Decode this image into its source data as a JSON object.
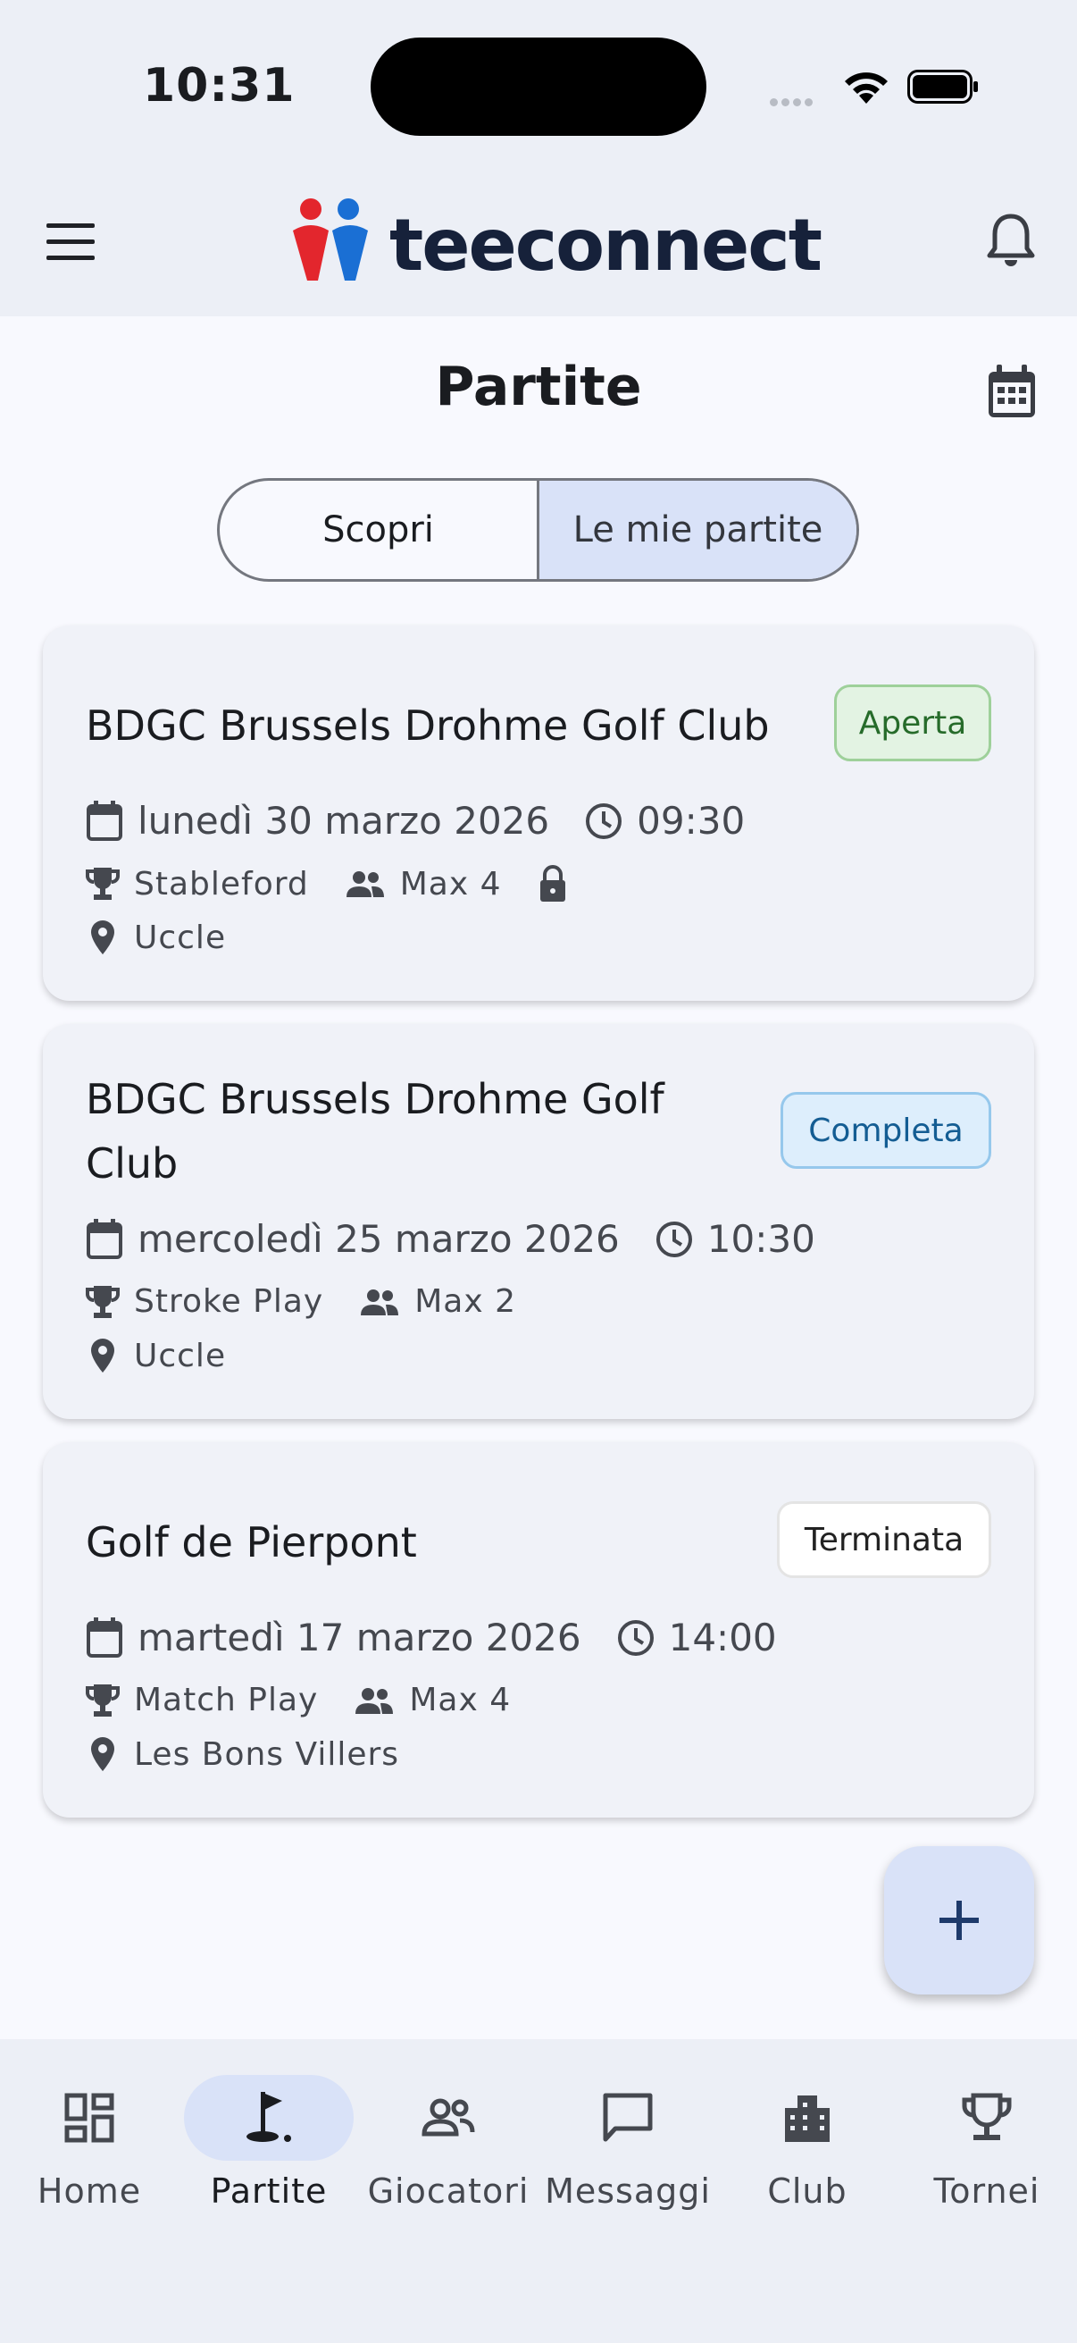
{
  "status": {
    "time": "10:31"
  },
  "header": {
    "app_name": "teeconnect"
  },
  "page": {
    "title": "Partite"
  },
  "tabs": [
    {
      "label": "Scopri",
      "active": false
    },
    {
      "label": "Le mie partite",
      "active": true
    }
  ],
  "matches": [
    {
      "club": "BDGC Brussels Drohme Golf Club",
      "status": "Aperta",
      "date": "lunedì 30 marzo 2026",
      "time": "09:30",
      "format": "Stableford",
      "players": "Max 4",
      "locked": true,
      "location": "Uccle"
    },
    {
      "club_line1": "BDGC Brussels Drohme Golf",
      "club_line2": "Club",
      "status": "Completa",
      "date": "mercoledì 25 marzo 2026",
      "time": "10:30",
      "format": "Stroke Play",
      "players": "Max 2",
      "location": "Uccle"
    },
    {
      "club": "Golf de Pierpont",
      "status": "Terminata",
      "date": "martedì 17 marzo 2026",
      "time": "14:00",
      "format": "Match Play",
      "players": "Max 4",
      "location": "Les Bons Villers"
    }
  ],
  "fab": {
    "icon": "plus-icon"
  },
  "bottom_nav": [
    {
      "label": "Home",
      "icon": "dashboard-icon",
      "active": false
    },
    {
      "label": "Partite",
      "icon": "golf-flag-icon",
      "active": true
    },
    {
      "label": "Giocatori",
      "icon": "people-icon",
      "active": false
    },
    {
      "label": "Messaggi",
      "icon": "chat-icon",
      "active": false
    },
    {
      "label": "Club",
      "icon": "building-icon",
      "active": false
    },
    {
      "label": "Tornei",
      "icon": "trophy-icon",
      "active": false
    }
  ],
  "colors": {
    "accent": "#d9e2f8",
    "brand_dark": "#16213a",
    "brand_red": "#e3262d",
    "brand_blue": "#1a6fd4"
  }
}
